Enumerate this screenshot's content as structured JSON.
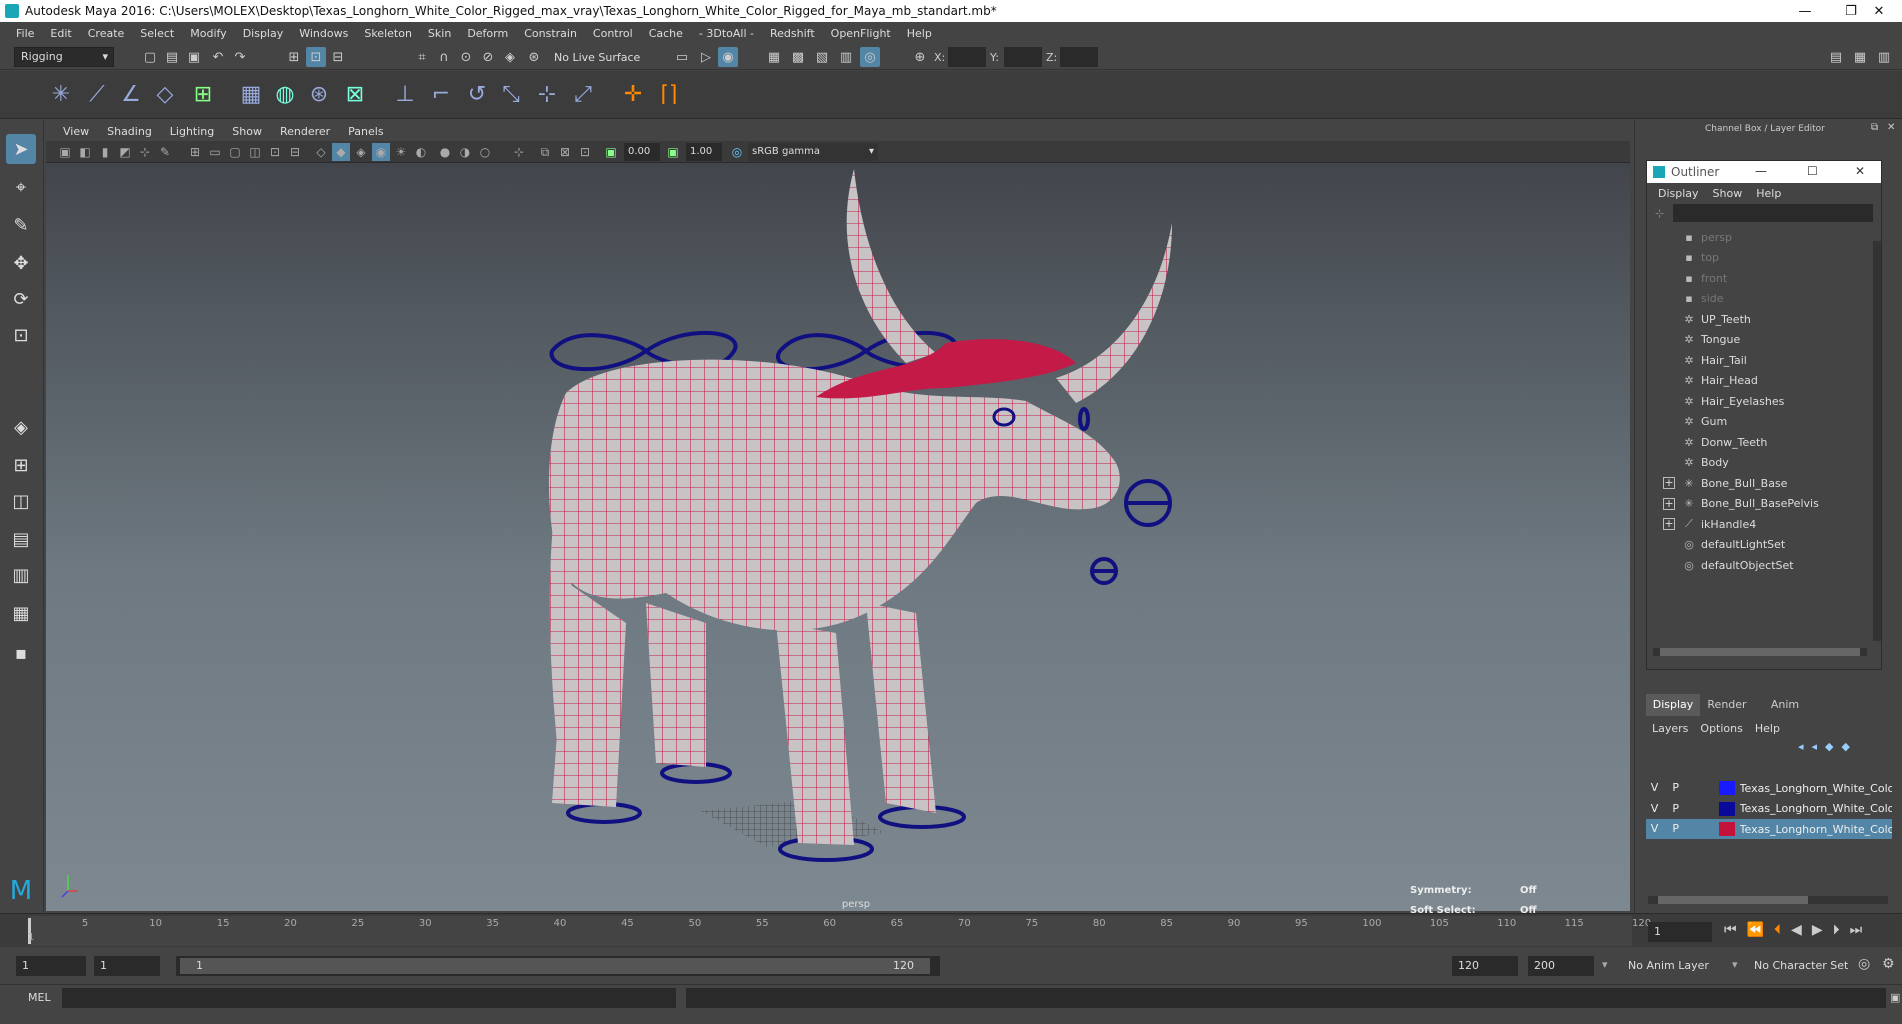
{
  "window": {
    "title": "Autodesk Maya 2016: C:\\Users\\MOLEX\\Desktop\\Texas_Longhorn_White_Color_Rigged_max_vray\\Texas_Longhorn_White_Color_Rigged_for_Maya_mb_standart.mb*",
    "minimize": "—",
    "restore": "❐",
    "close": "✕"
  },
  "menubar": [
    "File",
    "Edit",
    "Create",
    "Select",
    "Modify",
    "Display",
    "Windows",
    "Skeleton",
    "Skin",
    "Deform",
    "Constrain",
    "Control",
    "Cache",
    "- 3DtoAll -",
    "Redshift",
    "OpenFlight",
    "Help"
  ],
  "statusline": {
    "mode": "Rigging",
    "live_surface": "No Live Surface",
    "x_label": "X:",
    "y_label": "Y:",
    "z_label": "Z:"
  },
  "panel": {
    "menus": [
      "View",
      "Shading",
      "Lighting",
      "Show",
      "Renderer",
      "Panels"
    ],
    "exposure": "0.00",
    "gamma": "1.00",
    "color_space": "sRGB gamma"
  },
  "viewport": {
    "camera": "persp",
    "symmetry_label": "Symmetry:",
    "symmetry_value": "Off",
    "soft_select_label": "Soft Select:",
    "soft_select_value": "Off"
  },
  "channel_box": {
    "title": "Channel Box / Layer Editor"
  },
  "outliner": {
    "title": "Outliner",
    "menus": [
      "Display",
      "Show",
      "Help"
    ],
    "items": [
      {
        "label": "persp",
        "icon": "camera-icon",
        "dim": true
      },
      {
        "label": "top",
        "icon": "camera-icon",
        "dim": true
      },
      {
        "label": "front",
        "icon": "camera-icon",
        "dim": true
      },
      {
        "label": "side",
        "icon": "camera-icon",
        "dim": true
      },
      {
        "label": "UP_Teeth",
        "icon": "mesh-icon",
        "dim": false
      },
      {
        "label": "Tongue",
        "icon": "mesh-icon",
        "dim": false
      },
      {
        "label": "Hair_Tail",
        "icon": "mesh-icon",
        "dim": false
      },
      {
        "label": "Hair_Head",
        "icon": "mesh-icon",
        "dim": false
      },
      {
        "label": "Hair_Eyelashes",
        "icon": "mesh-icon",
        "dim": false
      },
      {
        "label": "Gum",
        "icon": "mesh-icon",
        "dim": false
      },
      {
        "label": "Donw_Teeth",
        "icon": "mesh-icon",
        "dim": false
      },
      {
        "label": "Body",
        "icon": "mesh-icon",
        "dim": false
      },
      {
        "label": "Bone_Bull_Base",
        "icon": "joint-icon",
        "dim": false,
        "expand": "+"
      },
      {
        "label": "Bone_Bull_BasePelvis",
        "icon": "joint-icon",
        "dim": false,
        "expand": "+"
      },
      {
        "label": "ikHandle4",
        "icon": "ik-handle-icon",
        "dim": false,
        "expand": "+"
      },
      {
        "label": "defaultLightSet",
        "icon": "set-icon",
        "dim": false
      },
      {
        "label": "defaultObjectSet",
        "icon": "set-icon",
        "dim": false
      }
    ]
  },
  "layer_editor": {
    "tabs": [
      "Display",
      "Render",
      "Anim"
    ],
    "menus": [
      "Layers",
      "Options",
      "Help"
    ],
    "layers": [
      {
        "v": "V",
        "p": "P",
        "color": "#1a1aff",
        "name": "Texas_Longhorn_White_Color_"
      },
      {
        "v": "V",
        "p": "P",
        "color": "#0a0a9a",
        "name": "Texas_Longhorn_White_Color_"
      },
      {
        "v": "V",
        "p": "P",
        "color": "#c4123a",
        "name": "Texas_Longhorn_White_Color_"
      }
    ]
  },
  "timeline": {
    "ticks": [
      "1",
      "5",
      "10",
      "15",
      "20",
      "25",
      "30",
      "35",
      "40",
      "45",
      "50",
      "55",
      "60",
      "65",
      "70",
      "75",
      "80",
      "85",
      "90",
      "95",
      "100",
      "105",
      "110",
      "115",
      "120"
    ],
    "current_frame": "1"
  },
  "range": {
    "start": "1",
    "playback_start": "1",
    "slider_start": "1",
    "slider_end": "120",
    "playback_end": "120",
    "end": "200",
    "anim_layer": "No Anim Layer",
    "character_set": "No Character Set"
  },
  "command": {
    "label": "MEL"
  }
}
